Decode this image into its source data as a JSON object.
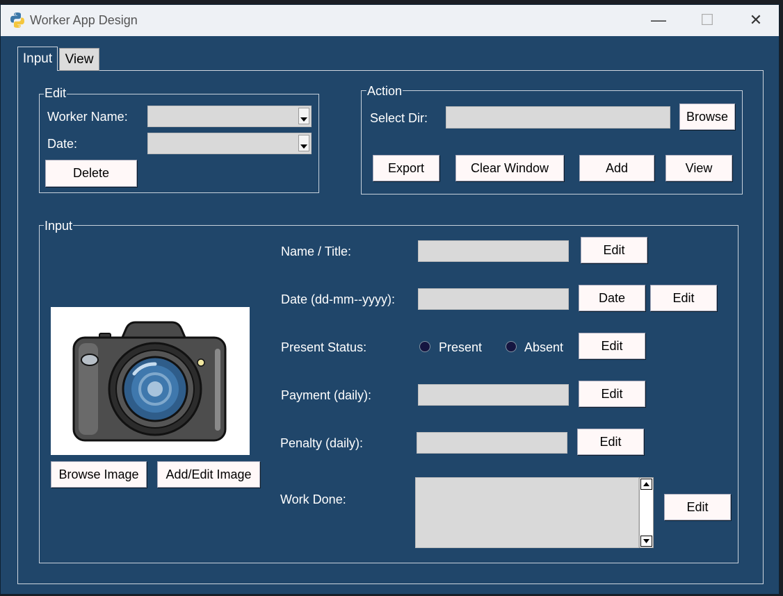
{
  "window": {
    "title": "Worker App Design"
  },
  "controls": {
    "minimize": "—",
    "maximize": "☐",
    "close": "✕"
  },
  "tabs": [
    {
      "label": "Input"
    },
    {
      "label": "View"
    }
  ],
  "edit_frame": {
    "title": "Edit",
    "worker_name_label": "Worker Name:",
    "worker_name_value": "",
    "date_label": "Date:",
    "date_value": "",
    "delete_button": "Delete"
  },
  "action_frame": {
    "title": "Action",
    "select_dir_label": "Select Dir:",
    "select_dir_value": "",
    "browse_button": "Browse",
    "export_button": "Export",
    "clear_button": "Clear Window",
    "add_button": "Add",
    "view_button": "View"
  },
  "input_frame": {
    "title": "Input",
    "browse_image_button": "Browse Image",
    "add_edit_image_button": "Add/Edit Image",
    "name_label": "Name / Title:",
    "date_label": "Date (dd-mm--yyyy):",
    "date_button": "Date",
    "status_label": "Present Status:",
    "present_label": "Present",
    "absent_label": "Absent",
    "payment_label": "Payment (daily):",
    "penalty_label": "Penalty (daily):",
    "work_done_label": "Work Done:",
    "edit_button": "Edit"
  },
  "icons": {
    "app": "python-icon",
    "photo": "camera-icon"
  },
  "colors": {
    "background": "#20466a",
    "button": "#fff8f8",
    "entry": "#d9d9d9"
  }
}
